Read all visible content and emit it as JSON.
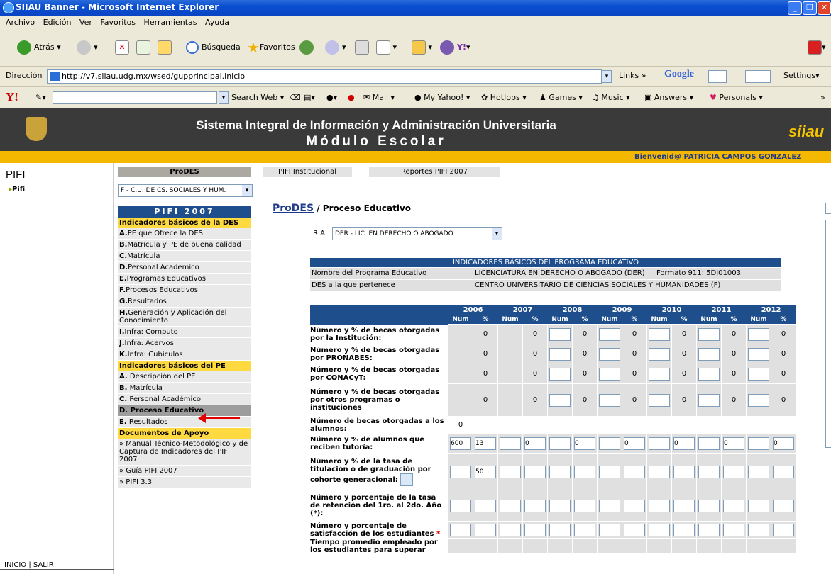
{
  "window": {
    "title": "SIIAU Banner - Microsoft Internet Explorer"
  },
  "menu": [
    "Archivo",
    "Edición",
    "Ver",
    "Favoritos",
    "Herramientas",
    "Ayuda"
  ],
  "toolbar": {
    "back": "Atrás",
    "search": "Búsqueda",
    "favorites": "Favoritos"
  },
  "address": {
    "label": "Dirección",
    "url": "http://v7.siiau.udg.mx/wsed/gupprincipal.inicio",
    "links": "Links",
    "google": "Google",
    "settings": "Settings"
  },
  "yahoo": {
    "search": "Search Web",
    "mail": "Mail",
    "myyahoo": "My Yahoo!",
    "hotjobs": "HotJobs",
    "games": "Games",
    "music": "Music",
    "answers": "Answers",
    "personals": "Personals"
  },
  "header": {
    "line1": "Sistema Integral de Información y Administración Universitaria",
    "line2": "Módulo Escolar",
    "logo": "siiau"
  },
  "welcome": "Bienvenid@  PATRICIA CAMPOS GONZALEZ",
  "left": {
    "title": "PIFI",
    "item": "Pifi",
    "footer": "INICIO | SALIR"
  },
  "prodes": {
    "header": "ProDES",
    "select": "F - C.U. DE CS. SOCIALES Y HUM."
  },
  "tabs": {
    "t1": "PIFI Institucional",
    "t2": "Reportes PIFI 2007"
  },
  "nav": {
    "title": "PIFI 2007",
    "sec1": "Indicadores básicos de la DES",
    "items1": [
      {
        "k": "A.",
        "t": "PE que Ofrece la DES"
      },
      {
        "k": "B.",
        "t": "Matrícula y PE de buena calidad"
      },
      {
        "k": "C.",
        "t": "Matrícula"
      },
      {
        "k": "D.",
        "t": "Personal Académico"
      },
      {
        "k": "E.",
        "t": "Programas Educativos"
      },
      {
        "k": "F.",
        "t": "Procesos Educativos"
      },
      {
        "k": "G.",
        "t": "Resultados"
      },
      {
        "k": "H.",
        "t": "Generación y Aplicación del Conocimiento"
      },
      {
        "k": "I.",
        "t": "Infra: Computo"
      },
      {
        "k": "J.",
        "t": "Infra: Acervos"
      },
      {
        "k": "K.",
        "t": "Infra: Cubiculos"
      }
    ],
    "sec2": "Indicadores básicos del PE",
    "items2": [
      {
        "k": "A.",
        "t": " Descripción del PE"
      },
      {
        "k": "B.",
        "t": " Matrícula"
      },
      {
        "k": "C.",
        "t": " Personal Académico"
      },
      {
        "k": "D.",
        "t": " Proceso Educativo"
      },
      {
        "k": "E.",
        "t": " Resultados"
      }
    ],
    "sec3": "Documentos de Apoyo",
    "docs": [
      "» Manual Técnico-Metodológico y de Captura de Indicadores del PIFI 2007",
      "» Guía PIFI 2007",
      "» PIFI 3.3"
    ]
  },
  "crumb": {
    "link": "ProDES",
    "rest": " / Proceso Educativo"
  },
  "ira": {
    "label": "IR A:",
    "value": "DER - LIC. EN DERECHO O ABOGADO"
  },
  "info": {
    "title": "INDICADORES BÁSICOS DEL PROGRAMA EDUCATIVO",
    "r1l": "Nombre del Programa Educativo",
    "r1v": "LICENCIATURA EN DERECHO O ABOGADO (DER)",
    "r1f": "Formato 911: 5DJ01003",
    "r2l": "DES a la que pertenece",
    "r2v": "CENTRO UNIVERSITARIO DE CIENCIAS SOCIALES Y HUMANIDADES (F)"
  },
  "years": [
    "2006",
    "2007",
    "2008",
    "2009",
    "2010",
    "2011",
    "2012"
  ],
  "sub": {
    "num": "Num",
    "pct": "%"
  },
  "rows": [
    {
      "label": "Número y % de becas otorgadas por la Institución:",
      "vals": [
        "",
        "0",
        "",
        "0",
        "",
        "0",
        "",
        "0",
        "",
        "0",
        "",
        "0",
        "",
        "0"
      ]
    },
    {
      "label": "Número y % de becas otorgadas por PRONABES:",
      "vals": [
        "",
        "0",
        "",
        "0",
        "",
        "0",
        "",
        "0",
        "",
        "0",
        "",
        "0",
        "",
        "0"
      ]
    },
    {
      "label": "Número y % de becas otorgadas por CONACyT:",
      "vals": [
        "",
        "0",
        "",
        "0",
        "",
        "0",
        "",
        "0",
        "",
        "0",
        "",
        "0",
        "",
        "0"
      ]
    },
    {
      "label": "Número y % de becas otorgadas por otros programas o instituciones",
      "vals": [
        "",
        "0",
        "",
        "0",
        "",
        "0",
        "",
        "0",
        "",
        "0",
        "",
        "0",
        "",
        "0"
      ]
    },
    {
      "label": "Número de becas otorgadas a los alumnos:",
      "single": "0"
    },
    {
      "label": "Número y % de alumnos que reciben tutoría:",
      "vals": [
        "600",
        "13",
        "",
        "0",
        "",
        "0",
        "",
        "0",
        "",
        "0",
        "",
        "0",
        "",
        "0"
      ]
    },
    {
      "label": "Número y % de la tasa de titulación o de graduación por cohorte generacional:",
      "vals": [
        "",
        "50",
        "",
        "",
        "",
        "",
        "",
        "",
        "",
        "",
        "",
        "",
        "",
        ""
      ]
    },
    {
      "label": "Número y porcentaje de la tasa de retención del 1ro. al 2do. Año (*):",
      "vals": [
        "",
        "",
        "",
        "",
        "",
        "",
        "",
        "",
        "",
        "",
        "",
        "",
        "",
        ""
      ]
    },
    {
      "label": "Número y porcentaje de satisfacción de los estudiantes",
      "vals": [
        "",
        "",
        "",
        "",
        "",
        "",
        "",
        "",
        "",
        "",
        "",
        "",
        "",
        ""
      ]
    },
    {
      "label": "Tiempo promedio empleado por los estudiantes para superar",
      "vals": null
    }
  ]
}
